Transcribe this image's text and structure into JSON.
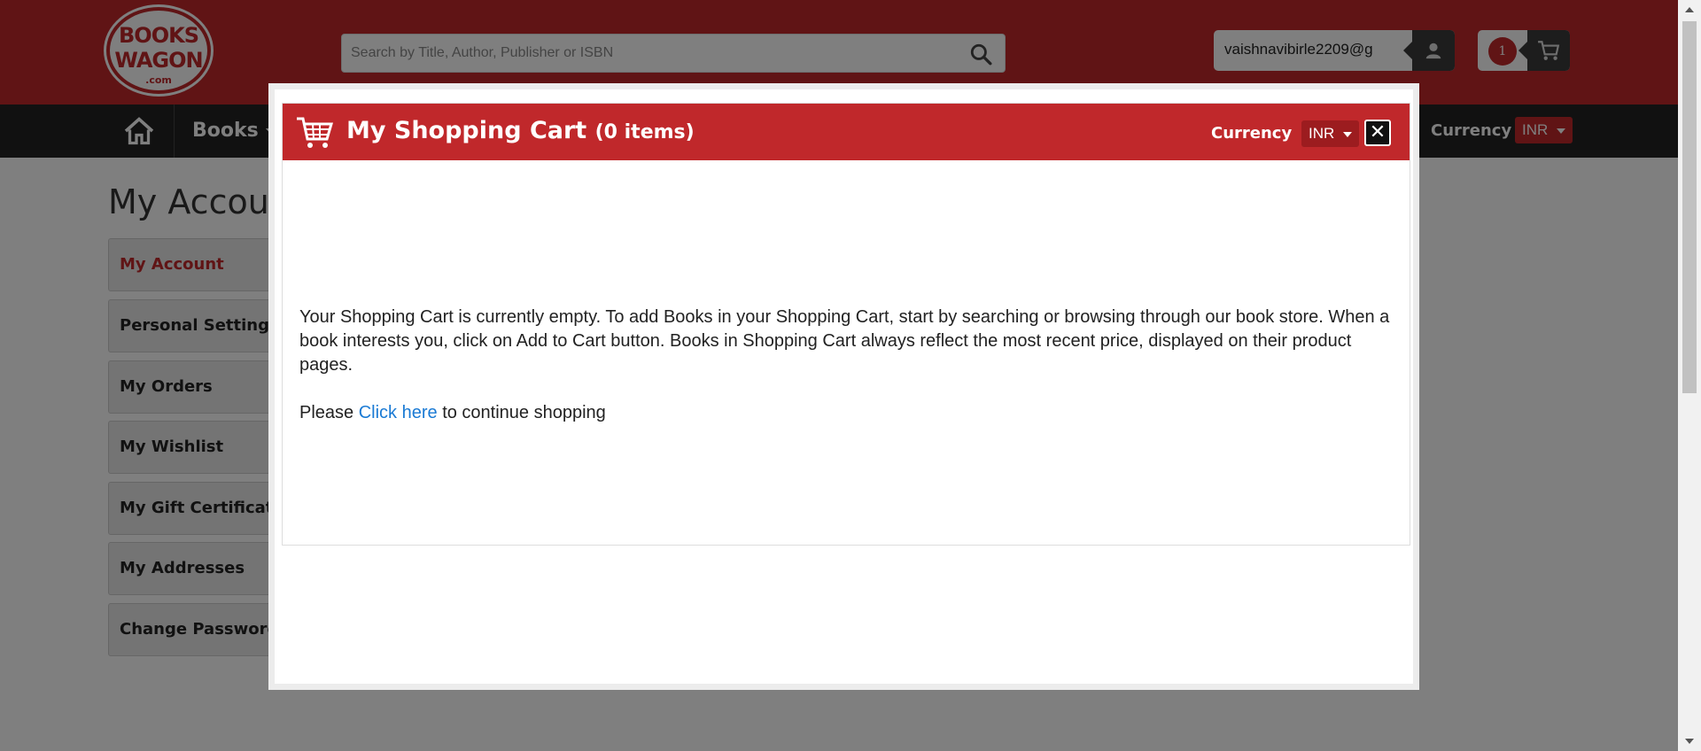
{
  "header": {
    "logo": {
      "line1": "BOOKS",
      "line2": "WAGON",
      "line3": ".com"
    },
    "search": {
      "placeholder": "Search by Title, Author, Publisher or ISBN"
    },
    "account": {
      "email": "vaishnavibirle2209@g"
    },
    "cart": {
      "count": "1"
    }
  },
  "nav": {
    "books_label": "Books",
    "currency_label": "Currency",
    "currency_value": "INR"
  },
  "page": {
    "title": "My Account",
    "sidebar": [
      {
        "label": "My Account",
        "active": true
      },
      {
        "label": "Personal Settings"
      },
      {
        "label": "My Orders"
      },
      {
        "label": "My Wishlist"
      },
      {
        "label": "My Gift Certificates"
      },
      {
        "label": "My Addresses"
      },
      {
        "label": "Change Password"
      }
    ]
  },
  "modal": {
    "title": "My Shopping Cart",
    "item_count": "(0 items)",
    "currency_label": "Currency",
    "currency_value": "INR",
    "close_symbol": "✕",
    "empty_message": "Your Shopping Cart is currently empty. To add Books in your Shopping Cart, start by searching or browsing through our book store. When a book interests you, click on Add to Cart button. Books in Shopping Cart always reflect the most recent price, displayed on their product pages.",
    "continue_prefix": "Please ",
    "continue_link": "Click here",
    "continue_suffix": " to continue shopping"
  },
  "colors": {
    "brand_red": "#c0282b",
    "link_blue": "#1a7ad4"
  }
}
